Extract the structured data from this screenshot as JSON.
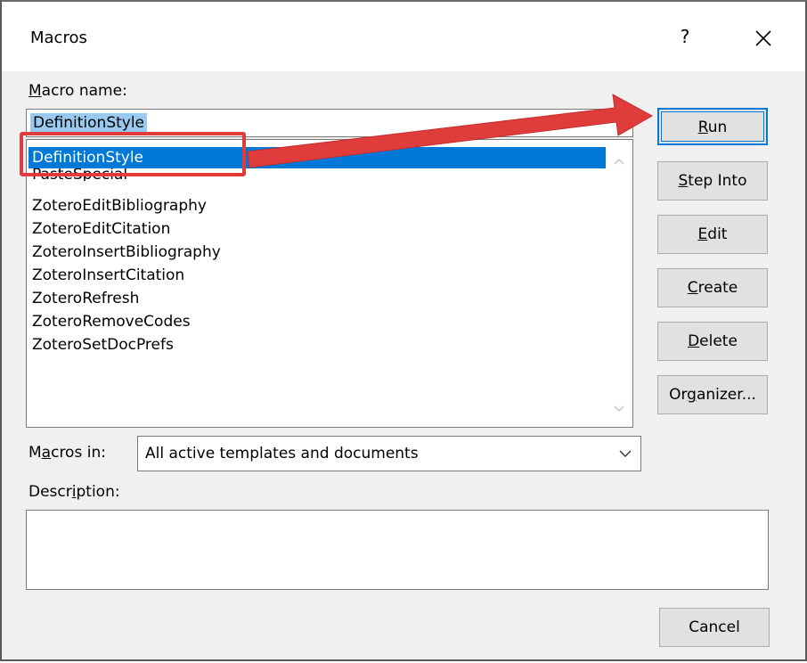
{
  "window": {
    "title": "Macros",
    "help": "?",
    "close": "×"
  },
  "macro_name": {
    "label_u": "M",
    "label_rest": "acro name:",
    "value": "DefinitionStyle"
  },
  "list": {
    "items": [
      "DefinitionStyle",
      "PasteSpecial",
      "ZoteroEditBibliography",
      "ZoteroEditCitation",
      "ZoteroInsertBibliography",
      "ZoteroInsertCitation",
      "ZoteroRefresh",
      "ZoteroRemoveCodes",
      "ZoteroSetDocPrefs"
    ],
    "selected_index": 0
  },
  "buttons": {
    "run": {
      "u": "R",
      "rest": "un"
    },
    "step_into": {
      "u": "S",
      "rest": "tep Into"
    },
    "edit": {
      "u": "E",
      "rest": "dit"
    },
    "create": {
      "u": "C",
      "rest": "reate"
    },
    "delete": {
      "u": "D",
      "rest": "elete"
    },
    "organizer": {
      "pre": "Or",
      "u": "g",
      "rest": "anizer..."
    },
    "cancel": "Cancel"
  },
  "macros_in": {
    "label_pre": "M",
    "label_u": "a",
    "label_rest": "cros in:",
    "value": "All active templates and documents"
  },
  "description": {
    "label_pre": "Descr",
    "label_u": "i",
    "label_rest": "ption:",
    "value": ""
  },
  "annotation": {
    "highlight_color": "#e03c3c",
    "arrow_color": "#e03c3c"
  },
  "colors": {
    "selection": "#0078d7",
    "text_selection": "#99c9ef"
  }
}
